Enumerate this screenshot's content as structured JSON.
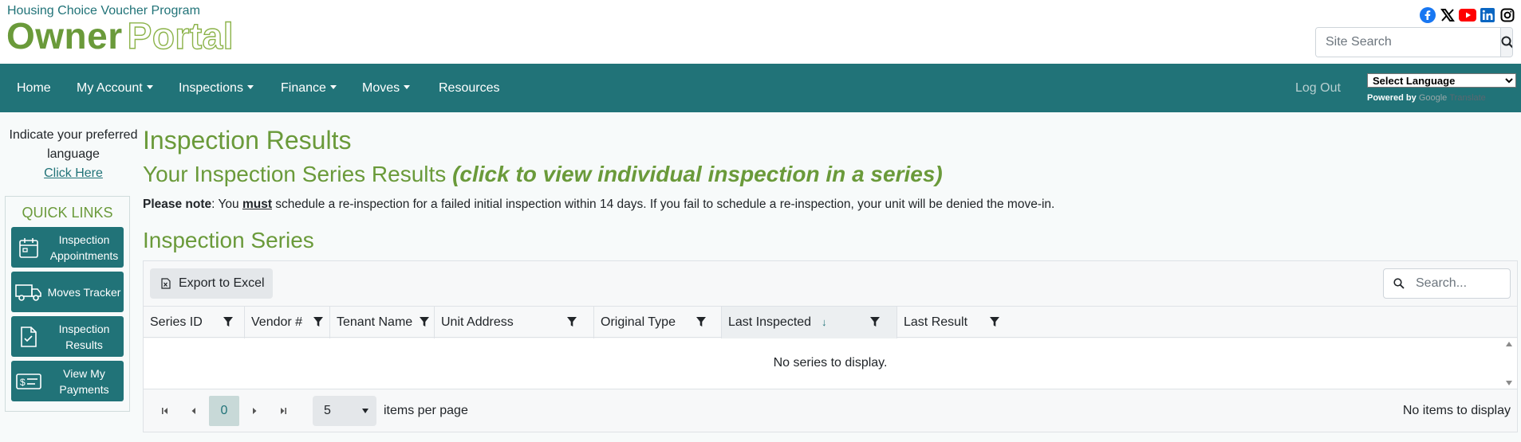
{
  "header": {
    "program": "Housing Choice Voucher Program",
    "logo_part1": "Owner",
    "logo_part2": "Portal",
    "search_placeholder": "Site Search",
    "social": [
      "facebook-icon",
      "x-twitter-icon",
      "youtube-icon",
      "linkedin-icon",
      "instagram-icon"
    ]
  },
  "nav": {
    "items": [
      {
        "label": "Home",
        "dropdown": false
      },
      {
        "label": "My Account",
        "dropdown": true
      },
      {
        "label": "Inspections",
        "dropdown": true
      },
      {
        "label": "Finance",
        "dropdown": true
      },
      {
        "label": "Moves",
        "dropdown": true
      },
      {
        "label": "Resources",
        "dropdown": false
      }
    ],
    "logout": "Log Out",
    "language_select": "Select Language",
    "powered_by": "Powered by",
    "google": "Google",
    "translate": "Translate"
  },
  "sidebar": {
    "lang_note": "Indicate your preferred language",
    "lang_link": "Click Here",
    "quick_links_title": "QUICK LINKS",
    "quick_links": [
      {
        "label": "Inspection Appointments",
        "icon": "calendar-icon"
      },
      {
        "label": "Moves Tracker",
        "icon": "truck-icon"
      },
      {
        "label": "Inspection Results",
        "icon": "document-check-icon"
      },
      {
        "label": "View My Payments",
        "icon": "money-bill-icon"
      }
    ]
  },
  "main": {
    "title": "Inspection Results",
    "subtitle": "Your Inspection Series Results",
    "subtitle_click": "(click",
    "subtitle_rest": "to view individual inspection in a series)",
    "note_label": "Please note",
    "note_text1": ": You ",
    "note_must": "must",
    "note_text2": " schedule a re-inspection for a failed initial inspection within 14 days. If you fail to schedule a re-inspection, your unit will be denied the move-in.",
    "section_title": "Inspection Series"
  },
  "grid": {
    "export_label": "Export to Excel",
    "search_placeholder": "Search...",
    "columns": [
      "Series ID",
      "Vendor #",
      "Tenant Name",
      "Unit Address",
      "Original Type",
      "Last Inspected",
      "Last Result"
    ],
    "sorted_column": "Last Inspected",
    "empty_message": "No series to display.",
    "current_page": "0",
    "page_size": "5",
    "items_per_page": "items per page",
    "status": "No items to display"
  },
  "colors": {
    "brand_teal": "#217378",
    "brand_green": "#6a9a3a"
  }
}
